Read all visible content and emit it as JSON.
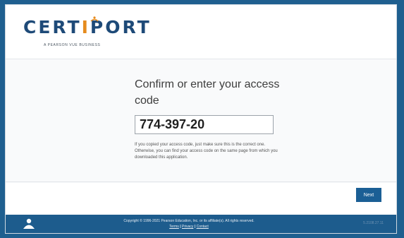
{
  "brand": {
    "logo_pre": "CERT",
    "logo_accent": "I",
    "logo_post": "PORT",
    "tagline": "A PEARSON VUE BUSINESS",
    "color_primary": "#1e4a78",
    "color_accent": "#e58b1e"
  },
  "main": {
    "prompt": "Confirm or enter your access code",
    "access_code_value": "774-397-20",
    "help_text": "If you copied your access code, just make sure this is the correct one. Otherwise, you can find your access code on the same page from which you downloaded this application."
  },
  "actions": {
    "next_label": "Next",
    "color": "#1b5f95"
  },
  "footer": {
    "copyright": "Copyright © 1996-2021 Pearson Education, Inc. or its affiliate(s). All rights reserved.",
    "link_terms": "Terms",
    "link_privacy": "Privacy",
    "link_contact": "Contact",
    "separator": "|",
    "version": "5.2108.27.11",
    "icon": "person-icon",
    "color": "#1d5c8d"
  }
}
